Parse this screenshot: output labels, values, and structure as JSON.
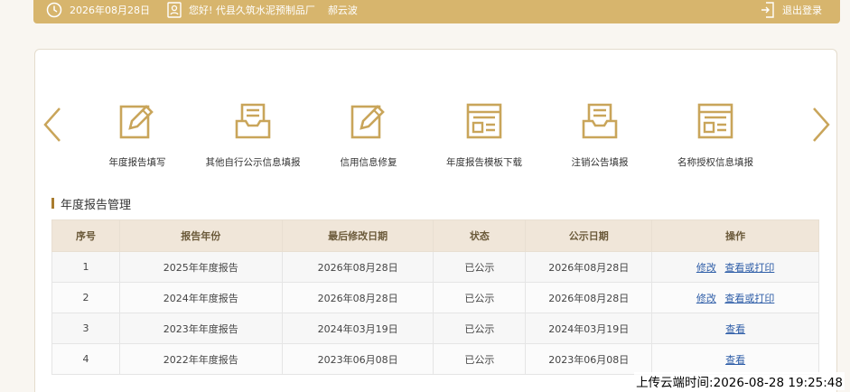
{
  "header": {
    "date": "2026年08月28日",
    "greeting": "您好!  代县久筑水泥预制品厂",
    "username": "郝云波",
    "logout_label": "退出登录"
  },
  "colors": {
    "accent": "#d7b56d",
    "icon": "#c9a55a",
    "link": "#2f5ea8"
  },
  "quick_actions": [
    {
      "label": "年度报告填写",
      "icon": "edit-form-icon"
    },
    {
      "label": "其他自行公示信息填报",
      "icon": "inbox-tray-icon"
    },
    {
      "label": "信用信息修复",
      "icon": "edit-form-icon"
    },
    {
      "label": "年度报告模板下载",
      "icon": "template-window-icon"
    },
    {
      "label": "注销公告填报",
      "icon": "inbox-tray-icon"
    },
    {
      "label": "名称授权信息填报",
      "icon": "template-window-icon"
    }
  ],
  "section": {
    "title": "年度报告管理"
  },
  "table": {
    "headers": [
      "序号",
      "报告年份",
      "最后修改日期",
      "状态",
      "公示日期",
      "操作"
    ],
    "rows": [
      {
        "no": "1",
        "year": "2025年年度报告",
        "modified": "2026年08月28日",
        "status": "已公示",
        "published": "2026年08月28日",
        "edit": "修改",
        "view": "查看或打印"
      },
      {
        "no": "2",
        "year": "2024年年度报告",
        "modified": "2026年08月28日",
        "status": "已公示",
        "published": "2026年08月28日",
        "edit": "修改",
        "view": "查看或打印"
      },
      {
        "no": "3",
        "year": "2023年年度报告",
        "modified": "2024年03月19日",
        "status": "已公示",
        "published": "2024年03月19日",
        "view": "查看"
      },
      {
        "no": "4",
        "year": "2022年年度报告",
        "modified": "2023年06月08日",
        "status": "已公示",
        "published": "2023年06月08日",
        "view": "查看"
      }
    ]
  },
  "watermark": "上传云端时间:2026-08-28 19:25:48"
}
